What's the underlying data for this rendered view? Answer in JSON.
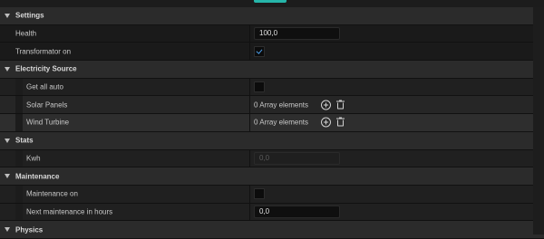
{
  "sections": {
    "settings": {
      "title": "Settings",
      "health": {
        "label": "Health",
        "value": "100,0"
      },
      "transformator": {
        "label": "Transformator on",
        "checked": true
      }
    },
    "electricity": {
      "title": "Electricity Source",
      "get_all_auto": {
        "label": "Get all auto",
        "checked": false
      },
      "solar_panels": {
        "label": "Solar Panels",
        "value": "0 Array elements"
      },
      "wind_turbine": {
        "label": "Wind Turbine",
        "value": "0 Array elements"
      }
    },
    "stats": {
      "title": "Stats",
      "kwh": {
        "label": "Kwh",
        "value": "0,0"
      }
    },
    "maintenance": {
      "title": "Maintenance",
      "maintenance_on": {
        "label": "Maintenance on",
        "checked": false
      },
      "next_hours": {
        "label": "Next maintenance in hours",
        "value": "0,0"
      }
    },
    "physics": {
      "title": "Physics"
    }
  },
  "icons": {
    "expand": "triangle-down-icon",
    "add": "plus-circle-icon",
    "delete": "trash-icon"
  },
  "colors": {
    "accent": "#26b5a9",
    "check": "#4a9de8"
  }
}
